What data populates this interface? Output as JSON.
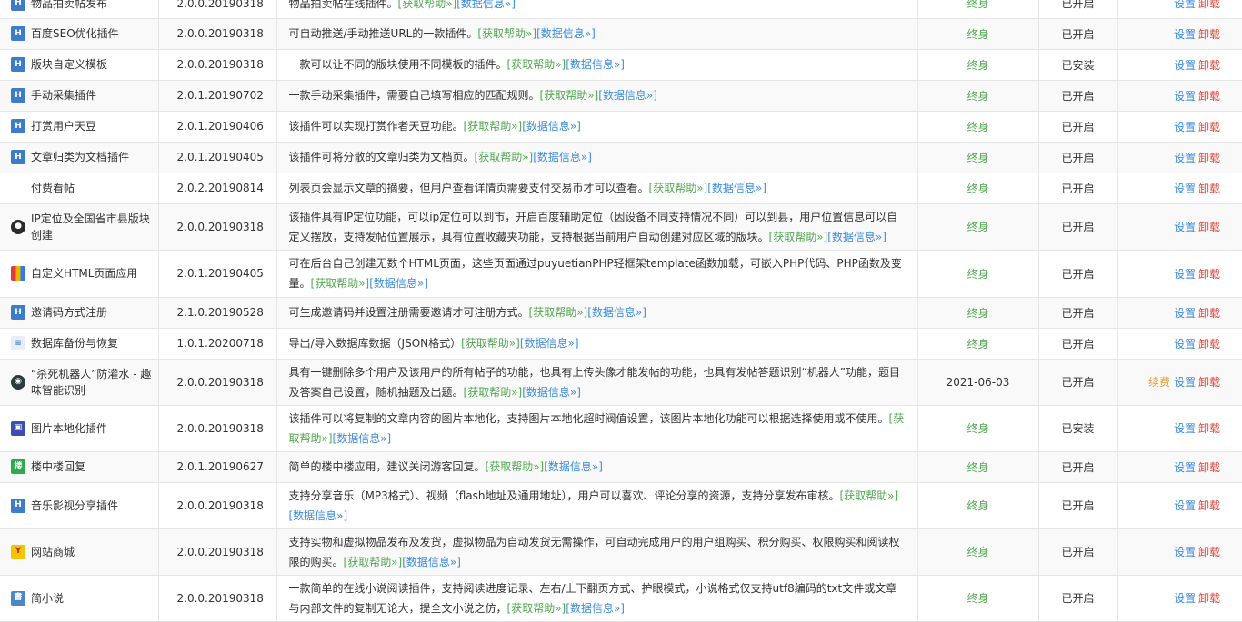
{
  "links": {
    "help": "[获取帮助»]",
    "data": "[数据信息»]"
  },
  "actions": {
    "renew": "续费",
    "settings": "设置",
    "uninstall": "卸载"
  },
  "plugins": [
    {
      "name": "物品拍卖帖发布",
      "icon": "puyuetian-logo-icon",
      "version": "2.0.0.20190318",
      "desc": "物品拍卖帖在线插件。",
      "expiry": "终身",
      "status": "已开启",
      "renew": false
    },
    {
      "name": "百度SEO优化插件",
      "icon": "puyuetian-logo-icon",
      "version": "2.0.0.20190318",
      "desc": "可自动推送/手动推送URL的一款插件。",
      "expiry": "终身",
      "status": "已开启",
      "renew": false
    },
    {
      "name": "版块自定义模板",
      "icon": "puyuetian-logo-icon",
      "version": "2.0.0.20190318",
      "desc": "一款可以让不同的版块使用不同模板的插件。",
      "expiry": "终身",
      "status": "已安装",
      "renew": false
    },
    {
      "name": "手动采集插件",
      "icon": "puyuetian-logo-icon",
      "version": "2.0.1.20190702",
      "desc": "一款手动采集插件，需要自己填写相应的匹配规则。",
      "expiry": "终身",
      "status": "已开启",
      "renew": false
    },
    {
      "name": "打赏用户天豆",
      "icon": "puyuetian-logo-icon",
      "version": "2.0.1.20190406",
      "desc": "该插件可以实现打赏作者天豆功能。",
      "expiry": "终身",
      "status": "已开启",
      "renew": false
    },
    {
      "name": "文章归类为文档插件",
      "icon": "puyuetian-logo-icon",
      "version": "2.0.1.20190405",
      "desc": "该插件可将分散的文章归类为文档页。",
      "expiry": "终身",
      "status": "已开启",
      "renew": false
    },
    {
      "name": "付费看帖",
      "icon": "blank-icon",
      "version": "2.0.2.20190814",
      "desc": "列表页会显示文章的摘要，但用户查看详情页需要支付交易币才可以查看。",
      "expiry": "终身",
      "status": "已开启",
      "renew": false
    },
    {
      "name": "IP定位及全国省市县版块创建",
      "icon": "location-pin-icon",
      "version": "2.0.0.20190318",
      "desc": "该插件具有IP定位功能，可以ip定位可以到市，开启百度辅助定位（因设备不同支持情况不同）可以到县，用户位置信息可以自定义摆放，支持发帖位置展示，具有位置收藏夹功能，支持根据当前用户自动创建对应区域的版块。",
      "expiry": "终身",
      "status": "已开启",
      "renew": false
    },
    {
      "name": "自定义HTML页面应用",
      "icon": "html-page-icon",
      "version": "2.0.1.20190405",
      "desc": "可在后台自己创建无数个HTML页面，这些页面通过puyuetianPHP轻框架template函数加载，可嵌入PHP代码、PHP函数及变量。",
      "expiry": "终身",
      "status": "已开启",
      "renew": false
    },
    {
      "name": "邀请码方式注册",
      "icon": "puyuetian-logo-icon",
      "version": "2.1.0.20190528",
      "desc": "可生成邀请码并设置注册需要邀请才可注册方式。",
      "expiry": "终身",
      "status": "已开启",
      "renew": false
    },
    {
      "name": "数据库备份与恢复",
      "icon": "database-icon",
      "version": "1.0.1.20200718",
      "desc": "导出/导入数据库数据（JSON格式）",
      "expiry": "终身",
      "status": "已开启",
      "renew": false
    },
    {
      "name": "“杀死机器人”防灌水 - 趣味智能识别",
      "icon": "robot-icon",
      "version": "2.0.0.20190318",
      "desc": "具有一键删除多个用户及该用户的所有帖子的功能，也具有上传头像才能发帖的功能，也具有发帖答题识别“机器人”功能，题目及答案自己设置，随机抽题及出题。",
      "expiry": "2021-06-03",
      "status": "已开启",
      "renew": true
    },
    {
      "name": "图片本地化插件",
      "icon": "image-icon",
      "version": "2.0.0.20190318",
      "desc": "该插件可以将复制的文章内容的图片本地化，支持图片本地化超时阀值设置，该图片本地化功能可以根据选择使用或不使用。",
      "expiry": "终身",
      "status": "已安装",
      "renew": false
    },
    {
      "name": "楼中楼回复",
      "icon": "floor-reply-icon",
      "version": "2.0.1.20190627",
      "desc": "简单的楼中楼应用，建议关闭游客回复。",
      "expiry": "终身",
      "status": "已开启",
      "renew": false
    },
    {
      "name": "音乐影视分享插件",
      "icon": "puyuetian-logo-icon",
      "version": "2.0.0.20190318",
      "desc": "支持分享音乐（MP3格式）、视频（flash地址及通用地址），用户可以喜欢、评论分享的资源，支持分享发布审核。",
      "expiry": "终身",
      "status": "已开启",
      "renew": false
    },
    {
      "name": "网站商城",
      "icon": "shop-icon",
      "version": "2.0.0.20190318",
      "desc": "支持实物和虚拟物品发布及发货，虚拟物品为自动发货无需操作，可自动完成用户的用户组购买、积分购买、权限购买和阅读权限的购买。",
      "expiry": "终身",
      "status": "已开启",
      "renew": false
    },
    {
      "name": "简小说",
      "icon": "novel-icon",
      "version": "2.0.0.20190318",
      "desc": "一款简单的在线小说阅读插件，支持阅读进度记录、左右/上下翻页方式、护眼模式，小说格式仅支持utf8编码的txt文件或文章与内部文件的复制无论大，提全文小说之仿，",
      "expiry": "终身",
      "status": "已开启",
      "renew": false
    }
  ]
}
